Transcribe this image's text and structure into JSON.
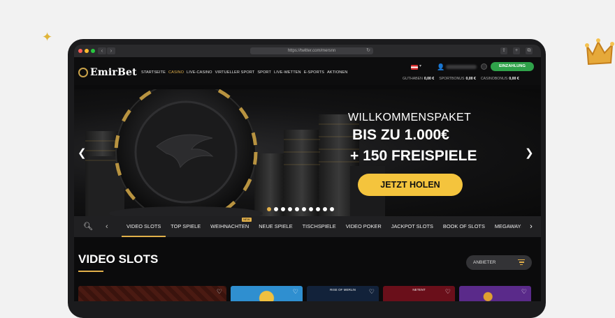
{
  "browser": {
    "url": "https://twitter.com/mersnn"
  },
  "header": {
    "logo": "EmirBet",
    "nav": [
      "STARTSEITE",
      "CASINO",
      "LIVE-CASINO",
      "VIRTUELLER SPORT",
      "SPORT",
      "LIVE-WETTEN",
      "E-SPORTS",
      "AKTIONEN"
    ],
    "active_nav": "CASINO",
    "deposit_label": "EINZAHLUNG",
    "balances": [
      {
        "label": "GUTHABEN",
        "value": "0,00 €"
      },
      {
        "label": "SPORTBONUS",
        "value": "0,00 €"
      },
      {
        "label": "CASINOBONUS",
        "value": "0,00 €"
      }
    ]
  },
  "hero": {
    "line1": "WILLKOMMENSPAKET",
    "line2": "BIS ZU 1.000€",
    "line3": "+ 150 FREISPIELE",
    "cta": "JETZT HOLEN",
    "prev_icon": "chevron-left-icon",
    "next_icon": "chevron-right-icon",
    "slide_count": 10,
    "active_slide": 1
  },
  "categories": {
    "items": [
      "VIDEO SLOTS",
      "TOP SPIELE",
      "WEIHNACHTEN",
      "NEUE SPIELE",
      "TISCHSPIELE",
      "VIDEO POKER",
      "JACKPOT SLOTS",
      "BOOK OF SLOTS",
      "MEGAWAYS SLOTS"
    ],
    "active": "VIDEO SLOTS",
    "badge_on": "WEIHNACHTEN",
    "badge_text": "NEW"
  },
  "section": {
    "title": "VIDEO SLOTS",
    "sort_label": "ANBIETER"
  },
  "tiles": [
    {
      "color": "#4a1a12",
      "label": ""
    },
    {
      "color": "#2f8fd0",
      "label": ""
    },
    {
      "color": "#12223a",
      "label": "RISE OF MERLIN"
    },
    {
      "color": "#6a0f1a",
      "label": "NETENT"
    },
    {
      "color": "#5a2a8a",
      "label": ""
    }
  ],
  "colors": {
    "accent": "#e2b04a",
    "deposit": "#2fa24a",
    "cta": "#f4c43d"
  }
}
